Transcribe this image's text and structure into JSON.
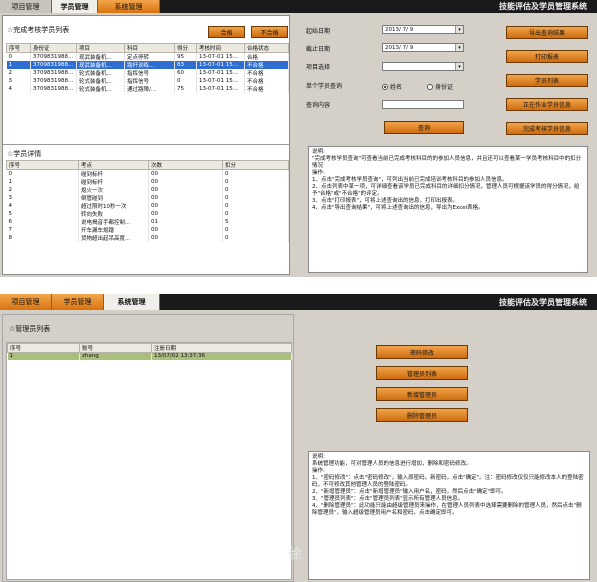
{
  "app_title": "技能评估及学员管理系统",
  "window1": {
    "tabs": [
      "项目管理",
      "学员管理",
      "系统管理"
    ],
    "active_tab": "学员管理",
    "completed_list": {
      "title": "☆完成考核学员列表",
      "btn_pass": "合格",
      "btn_fail": "不合格",
      "headers": [
        "序号",
        "身份证",
        "项目",
        "科目",
        "得分",
        "考核时间",
        "合格状态"
      ],
      "rows": [
        [
          "0",
          "3709831988...",
          "现武装备机...",
          "定点停转",
          "95",
          "13-07-01 15...",
          "合格"
        ],
        [
          "1",
          "3709831988...",
          "现武装备机...",
          "路杆训练...",
          "83",
          "13-07-01 15...",
          "不合格"
        ],
        [
          "2",
          "3709831988...",
          "轮式装备机...",
          "指挥信号",
          "60",
          "13-07-01 15...",
          "不合格"
        ],
        [
          "3",
          "3709831988...",
          "轮式装备机...",
          "指挥信号",
          "0",
          "13-07-01 15...",
          "不合格"
        ],
        [
          "4",
          "3709831988...",
          "轮式装备机...",
          "通过路障/...",
          "75",
          "13-07-01 15...",
          "不合格"
        ]
      ]
    },
    "detail": {
      "title": "☆学员详情",
      "headers": [
        "序号",
        "考点",
        "次数",
        "扣分"
      ],
      "rows": [
        [
          "0",
          "碰到标杆",
          "00",
          "0"
        ],
        [
          "1",
          "碰到标杆",
          "00",
          "0"
        ],
        [
          "2",
          "熄火一次",
          "00",
          "0"
        ],
        [
          "3",
          "倒管碰到",
          "00",
          "0"
        ],
        [
          "4",
          "超过限时10秒一次",
          "00",
          "0"
        ],
        [
          "5",
          "转向失败",
          "00",
          "0"
        ],
        [
          "6",
          "说电揭音手都控制...",
          "01",
          "5"
        ],
        [
          "7",
          "开车漏车熄蹭",
          "00",
          "0"
        ],
        [
          "8",
          "货物超出起吊高度...",
          "00",
          "0"
        ]
      ]
    },
    "query": {
      "start_label": "起始日期",
      "start_value": "2013/ 7/ 9",
      "end_label": "截止日期",
      "end_value": "2013/ 7/ 9",
      "project_label": "项目选择",
      "project_value": "",
      "single_label": "单个学员查询",
      "radio_name": "姓名",
      "radio_id": "身份证",
      "content_label": "查询内容",
      "content_value": "",
      "query_btn": "查询"
    },
    "actions": [
      "导出查询结果",
      "打印报表",
      "学员列表",
      "正在作业学员信息",
      "完成考核学员信息"
    ],
    "note": {
      "title": "说明:",
      "lines": [
        "\"完成考核学员查询\"可查看当前已完成考核科目的的参加人员信息，并且还可以查看某一学员考核科目中的扣分情况",
        "操作:",
        "1、点击\"完成考核学员查询\"，可列出当前已完成培训考核科目的参加人员信息。",
        "2、点击列表中某一项，可详细查看该学员已完成科目的详细扣分情况，管理人员可根据该学员的得分情况，给予\"合格\"或\"不合格\"的评定。",
        "3、点击\"打印报表\"，可将上述查询出的信息，打印出报表。",
        "4、点击\"导出查询结果\"，可将上述查询出的信息，导出为Excel表格。"
      ]
    }
  },
  "window2": {
    "tabs": [
      "项目管理",
      "学员管理",
      "系统管理"
    ],
    "active_tab": "系统管理",
    "admin_list": {
      "title": "☆管理员列表",
      "headers": [
        "序号",
        "账号",
        "注册日期"
      ],
      "rows": [
        [
          "1",
          "zhang",
          "13/07/02 13:37:36"
        ]
      ]
    },
    "actions": [
      "密码修改",
      "管理员列表",
      "新增管理员",
      "删除管理员"
    ],
    "note": {
      "title": "说明:",
      "lines": [
        "系统管理功能，可对管理人员的信息进行增加，删除和密码修改。",
        "操作:",
        "1、\"密码修改\"：点击\"密码修改\"，输入原密码，新密码，点击\"确定\"。注：密码修改仅仅只能修改本人的登陆密码，不可修改其他管理人员的登陆密码。",
        "2、\"新增管理员\"：点击\"新增管理员\"输入用户名，密码，然后点击\"确定\"即可。",
        "3、\"管理员列表\"：点击\"管理员列表\"显示所有管理人员信息。",
        "4、\"删除管理员\"：此功能只能由超级管理员来操作，在管理人员列表中选择需要删除的管理人员，然后点击\"删除管理员\"，输入超级管理员用户名和密码，点击确定即可。"
      ]
    },
    "watermark": "徐"
  },
  "colors": {
    "topbar": "#1a1a1a",
    "button_orange": "#e0851f",
    "selected_row": "#2f6dd1",
    "selected_row_green": "#a9bf7c",
    "panel_gray": "#d4d0c8"
  }
}
